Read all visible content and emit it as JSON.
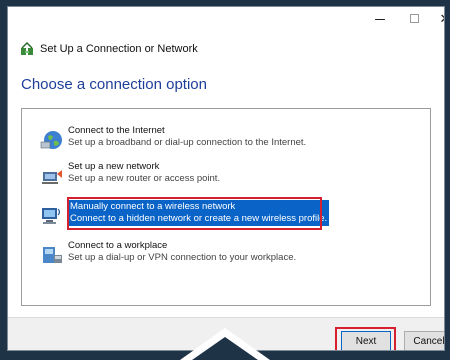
{
  "window": {
    "title": "Set Up a Connection or Network",
    "minimize_glyph": "",
    "close_glyph": "✕"
  },
  "main_instruction": "Choose a connection option",
  "options": [
    {
      "title": "Connect to the Internet",
      "description": "Set up a broadband or dial-up connection to the Internet.",
      "icon": "globe-network-icon"
    },
    {
      "title": "Set up a new network",
      "description": "Set up a new router or access point.",
      "icon": "router-icon"
    },
    {
      "title": "Manually connect to a wireless network",
      "description": "Connect to a hidden network or create a new wireless profile.",
      "icon": "wireless-computer-icon",
      "selected": true
    },
    {
      "title": "Connect to a workplace",
      "description": "Set up a dial-up or VPN connection to your workplace.",
      "icon": "workplace-phone-icon"
    }
  ],
  "buttons": {
    "next": "Next",
    "cancel": "Cancel"
  },
  "colors": {
    "selection": "#0a64c8",
    "highlight_outline": "#d5202f",
    "instruction_text": "#1e3f99",
    "background": "#1f3347"
  }
}
